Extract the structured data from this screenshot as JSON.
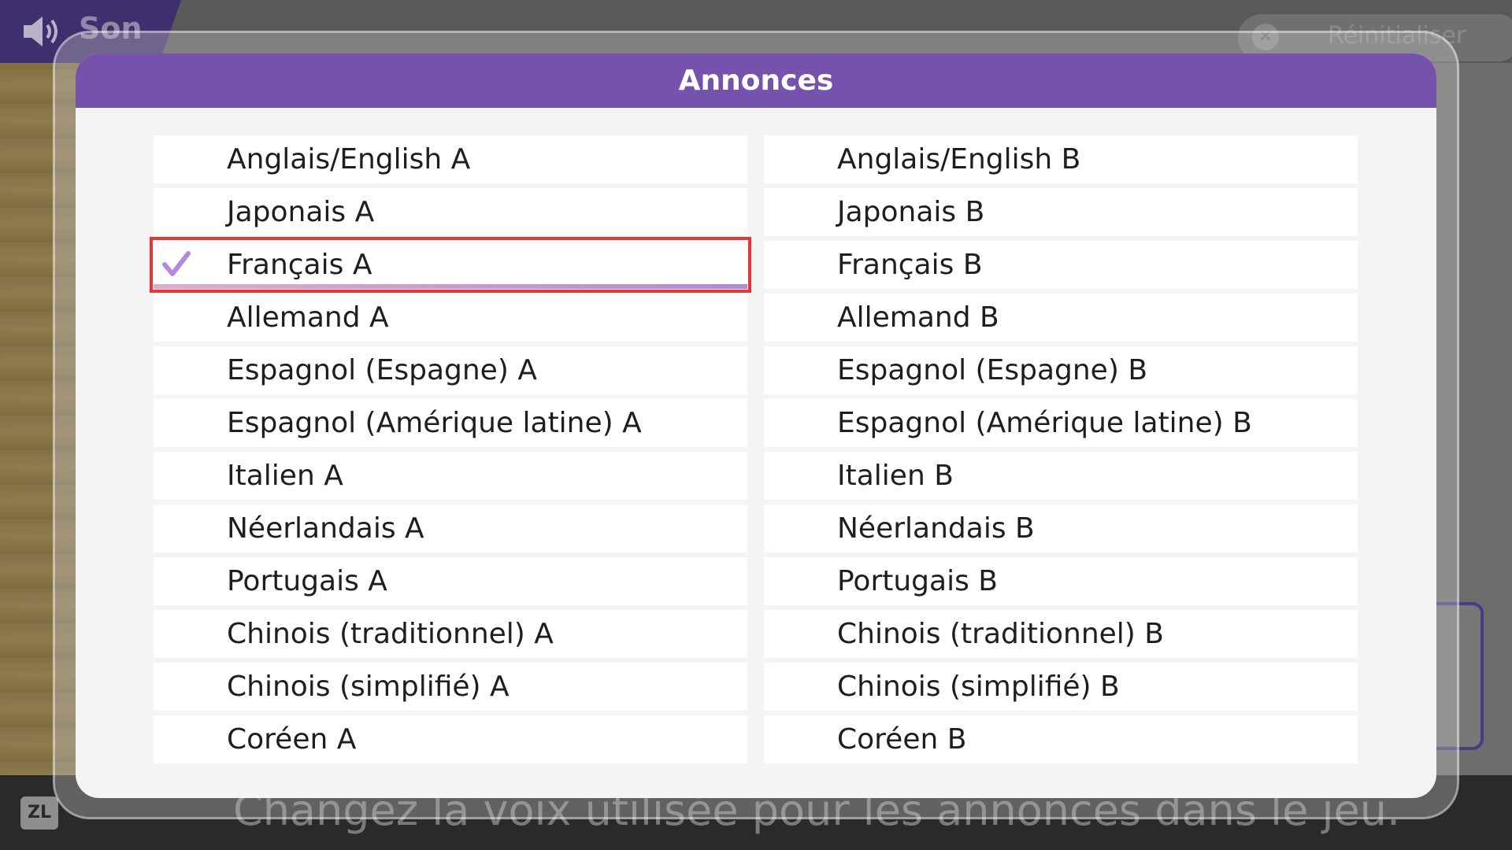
{
  "background": {
    "header_title": "Son",
    "reset_label": "Réinitialiser",
    "footer_button": "ZL",
    "hint": "Changez la voix utilisée pour les annonces dans le jeu."
  },
  "modal": {
    "title": "Annonces",
    "selected_option": "Français A",
    "accent_color": "#7552ab",
    "selection_color": "#e23838",
    "column_a": [
      "Anglais/English A",
      "Japonais A",
      "Français A",
      "Allemand A",
      "Espagnol (Espagne) A",
      "Espagnol (Amérique latine) A",
      "Italien A",
      "Néerlandais A",
      "Portugais A",
      "Chinois (traditionnel) A",
      "Chinois (simplifié) A",
      "Coréen A"
    ],
    "column_b": [
      "Anglais/English B",
      "Japonais B",
      "Français B",
      "Allemand B",
      "Espagnol (Espagne) B",
      "Espagnol (Amérique latine) B",
      "Italien B",
      "Néerlandais B",
      "Portugais B",
      "Chinois (traditionnel) B",
      "Chinois (simplifié) B",
      "Coréen B"
    ]
  }
}
